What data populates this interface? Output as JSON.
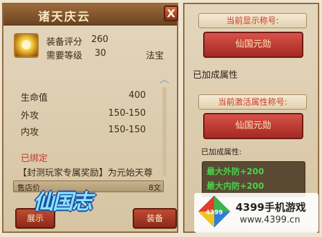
{
  "item_panel": {
    "title": "诸天庆云",
    "close_label": "X",
    "score_label": "装备评分",
    "score_value": "260",
    "level_label": "需要等级",
    "level_value": "30",
    "item_type": "法宝",
    "attributes": [
      {
        "label": "生命值",
        "value": "400"
      },
      {
        "label": "外攻",
        "value": "150-150"
      },
      {
        "label": "内攻",
        "value": "150-150"
      }
    ],
    "bound_text": "已绑定",
    "description": "【封测玩家专属奖励】为元始天尊",
    "sell_label": "售店价",
    "sell_value": "8文",
    "show_button": "展示",
    "equip_button": "装备"
  },
  "title_panel": {
    "current_display_header": "当前显示称号:",
    "current_display_title": "仙国元勋",
    "added_attributes_label": "已加成属性",
    "active_header": "当前激活属性称号:",
    "active_title": "仙国元勋",
    "active_attributes_label": "已加成属性:",
    "bonuses": [
      "最大外防+200",
      "最大内防+200"
    ]
  },
  "watermarks": {
    "left_logo": "仙国志",
    "right_logo_number": "4399",
    "right_logo_title": "4399手机游戏",
    "right_logo_url": "www.4399.cn"
  },
  "colors": {
    "panel_border": "#8d6a43",
    "title_red": "#a42a22",
    "header_red_text": "#d03a2a",
    "bonus_green": "#48d24a"
  }
}
